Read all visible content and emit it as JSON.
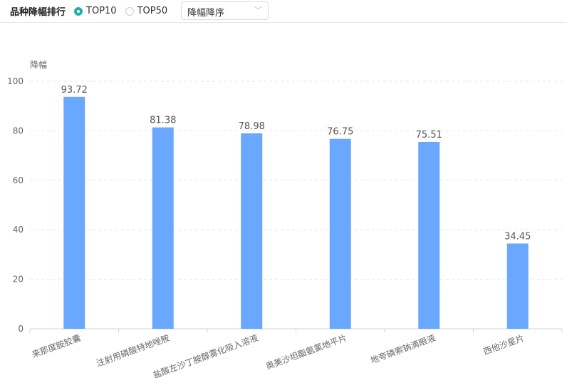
{
  "header": {
    "title": "品种降幅排行",
    "options": [
      "TOP10",
      "TOP50"
    ],
    "selected": "TOP10",
    "sort_value": "降幅降序"
  },
  "chart_data": {
    "type": "bar",
    "ylabel": "降幅",
    "ylim": [
      0,
      100
    ],
    "yticks": [
      0,
      20,
      40,
      60,
      80,
      100
    ],
    "grid": true,
    "color": "#6aa8ff",
    "categories": [
      "来那度胺胶囊",
      "注射用磷酸特地唑胺",
      "盐酸左沙丁胺醇雾化吸入溶液",
      "奥美沙坦酯氨氯地平片",
      "地夸磷索钠滴眼液",
      "西他沙星片"
    ],
    "values": [
      93.72,
      81.38,
      78.98,
      76.75,
      75.51,
      34.45
    ]
  }
}
